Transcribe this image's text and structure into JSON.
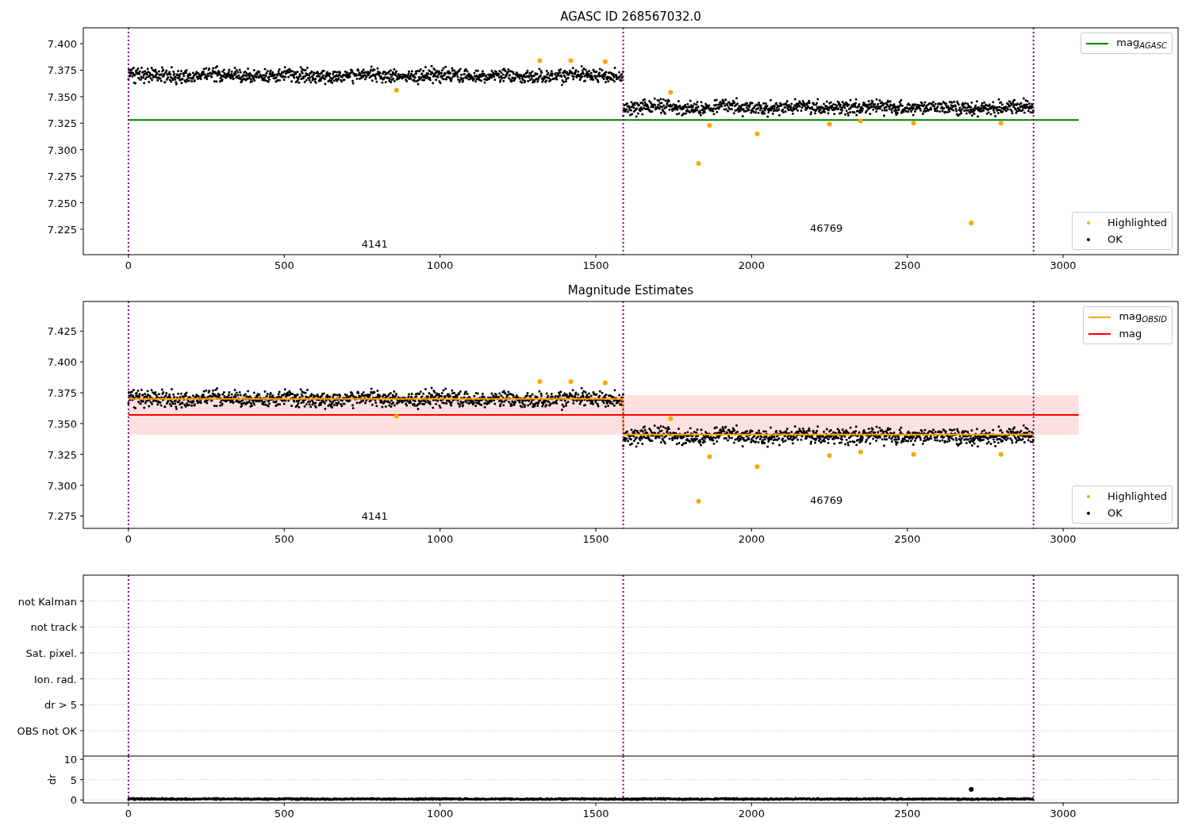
{
  "figure": {
    "panels": [
      {
        "chart_data": {
          "type": "scatter",
          "title": "AGASC ID 268567032.0",
          "legend": "right",
          "xlim": [
            -145,
            3369
          ],
          "ylim": [
            7.201,
            7.415
          ],
          "xticks": [
            0,
            500,
            1000,
            1500,
            2000,
            2500,
            3000
          ],
          "yticks": [
            {
              "value": 7.225,
              "label": "7.225"
            },
            {
              "value": 7.25,
              "label": "7.250"
            },
            {
              "value": 7.275,
              "label": "7.275"
            },
            {
              "value": 7.3,
              "label": "7.300"
            },
            {
              "value": 7.325,
              "label": "7.325"
            },
            {
              "value": 7.35,
              "label": "7.350"
            },
            {
              "value": 7.375,
              "label": "7.375"
            },
            {
              "value": 7.4,
              "label": "7.400"
            }
          ],
          "x": [
            0,
            860,
            1320,
            1420,
            1530,
            1740,
            1830,
            1865,
            2018,
            2250,
            2350,
            2520,
            2705,
            2800,
            3050
          ],
          "series": [
            {
              "name": "OK",
              "type": "scatter",
              "color": "#000000",
              "values": [
                null,
                null,
                null,
                null,
                null,
                null,
                null,
                null,
                null,
                null,
                null,
                null,
                null,
                null,
                null
              ]
            },
            {
              "name": "Highlighted",
              "type": "scatter",
              "color": "#ffa500",
              "values": [
                null,
                7.356,
                7.384,
                7.384,
                7.383,
                7.354,
                7.287,
                7.323,
                7.315,
                7.324,
                7.327,
                7.325,
                7.231,
                7.325,
                null
              ]
            },
            {
              "name": "mag$_{AGASC}$",
              "type": "line",
              "color": "#008000",
              "values": [
                7.328,
                7.328,
                7.328,
                7.328,
                7.328,
                7.328,
                7.328,
                7.328,
                7.328,
                7.328,
                7.328,
                7.328,
                7.328,
                7.328,
                7.328
              ]
            }
          ],
          "ref_lines": [
            {
              "axis": "x",
              "value": 0
            },
            {
              "axis": "x",
              "value": 1588
            },
            {
              "axis": "x",
              "value": 2905
            }
          ],
          "annotations": [
            "4141",
            "46769"
          ]
        }
      },
      {
        "chart_data": {
          "type": "scatter",
          "title": "Magnitude Estimates",
          "legend": "right",
          "xlim": [
            -145,
            3369
          ],
          "ylim": [
            7.265,
            7.449
          ],
          "xticks": [
            0,
            500,
            1000,
            1500,
            2000,
            2500,
            3000
          ],
          "yticks": [
            {
              "value": 7.275,
              "label": "7.275"
            },
            {
              "value": 7.3,
              "label": "7.300"
            },
            {
              "value": 7.325,
              "label": "7.325"
            },
            {
              "value": 7.35,
              "label": "7.350"
            },
            {
              "value": 7.375,
              "label": "7.375"
            },
            {
              "value": 7.4,
              "label": "7.400"
            },
            {
              "value": 7.425,
              "label": "7.425"
            }
          ],
          "x": [
            0,
            860,
            1320,
            1420,
            1530,
            1587,
            1589,
            1740,
            1830,
            1865,
            2018,
            2250,
            2350,
            2520,
            2800,
            2905,
            3050
          ],
          "series": [
            {
              "name": "OK",
              "type": "scatter",
              "color": "#000000",
              "values": [
                null,
                null,
                null,
                null,
                null,
                null,
                null,
                null,
                null,
                null,
                null,
                null,
                null,
                null,
                null,
                null,
                null
              ]
            },
            {
              "name": "Highlighted",
              "type": "scatter",
              "color": "#ffa500",
              "values": [
                null,
                7.356,
                7.384,
                7.384,
                7.383,
                null,
                null,
                7.354,
                7.287,
                7.323,
                7.315,
                7.324,
                7.327,
                7.325,
                7.325,
                null,
                null
              ]
            },
            {
              "name": "mag$_{OBSID}$",
              "type": "line",
              "color": "#ffa500",
              "values": [
                7.37,
                7.37,
                7.37,
                7.37,
                7.37,
                7.37,
                7.341,
                7.341,
                7.341,
                7.341,
                7.341,
                7.341,
                7.341,
                7.341,
                7.341,
                7.341,
                null
              ]
            },
            {
              "name": "mag",
              "type": "line",
              "color": "#ff0000",
              "values": [
                7.357,
                7.357,
                7.357,
                7.357,
                7.357,
                7.357,
                7.357,
                7.357,
                7.357,
                7.357,
                7.357,
                7.357,
                7.357,
                7.357,
                7.357,
                7.357,
                7.357
              ]
            }
          ],
          "bands": [
            {
              "axis": "y",
              "from": 7.341,
              "to": 7.373
            }
          ],
          "ref_lines": [
            {
              "axis": "x",
              "value": 0
            },
            {
              "axis": "x",
              "value": 1588
            },
            {
              "axis": "x",
              "value": 2905
            }
          ],
          "annotations": [
            "4141",
            "46769"
          ]
        }
      },
      {
        "chart_data": {
          "type": "other",
          "categories": [
            "OBS not OK",
            "dr > 5",
            "Ion. rad.",
            "Sat. pixel.",
            "not track",
            "not Kalman"
          ]
        }
      },
      {
        "chart_data": {
          "type": "scatter",
          "ylabel": "dr",
          "grid": true,
          "xlim": [
            -145,
            3369
          ],
          "ylim": [
            -0.7,
            10.8
          ],
          "xticks": [
            0,
            500,
            1000,
            1500,
            2000,
            2500,
            3000
          ],
          "yticks": [
            0,
            5,
            10
          ],
          "x": [
            2705
          ],
          "series": [
            {
              "type": "scatter",
              "color": "#000000",
              "values": [
                2.6
              ]
            }
          ],
          "ref_lines": [
            {
              "axis": "x",
              "value": 0
            },
            {
              "axis": "x",
              "value": 1588
            },
            {
              "axis": "x",
              "value": 2905
            }
          ]
        }
      }
    ]
  }
}
